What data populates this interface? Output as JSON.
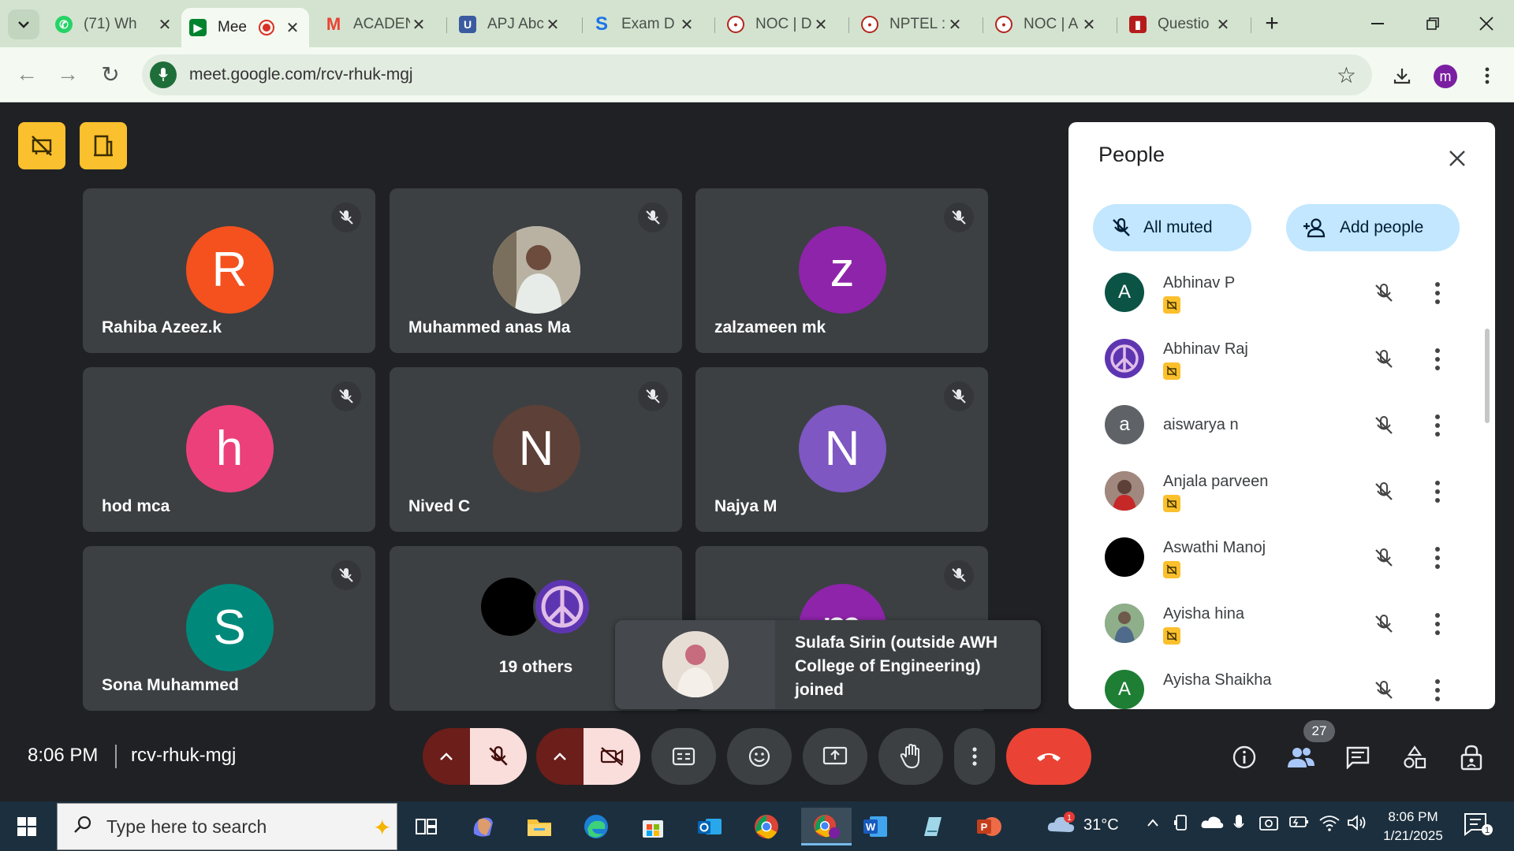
{
  "browser": {
    "tabs": [
      {
        "label": "(71) Wh",
        "favicon": "whatsapp-icon",
        "color": "#25d366"
      },
      {
        "label": "Mee",
        "favicon": "meet-icon",
        "color": "#00832d",
        "active": true,
        "recording": true
      },
      {
        "label": "ACADEN",
        "favicon": "gmail-icon",
        "color": "#ea4335"
      },
      {
        "label": "APJ Abc",
        "favicon": "university-icon",
        "color": "#3a5ba0"
      },
      {
        "label": "Exam D",
        "favicon": "s-icon",
        "color": "#1a73e8"
      },
      {
        "label": "NOC | D",
        "favicon": "nptel-icon",
        "color": "#b3261e"
      },
      {
        "label": "NPTEL :",
        "favicon": "nptel-icon",
        "color": "#b3261e"
      },
      {
        "label": "NOC | A",
        "favicon": "nptel-icon",
        "color": "#b3261e"
      },
      {
        "label": "Questio",
        "favicon": "ktu-icon",
        "color": "#b71c1c"
      }
    ],
    "url": "meet.google.com/rcv-rhuk-mgj",
    "profile_initial": "m"
  },
  "tiles": [
    {
      "name": "Rahiba Azeez.k",
      "initial": "R",
      "color": "#f4511e"
    },
    {
      "name": "Muhammed anas Ma",
      "initial": "",
      "color": "#cfd8dc",
      "photo": true
    },
    {
      "name": "zalzameen mk",
      "initial": "z",
      "color": "#8e24aa"
    },
    {
      "name": "hod mca",
      "initial": "h",
      "color": "#ec407a"
    },
    {
      "name": "Nived C",
      "initial": "N",
      "color": "#5d4037"
    },
    {
      "name": "Najya M",
      "initial": "N",
      "color": "#7e57c2"
    },
    {
      "name": "Sona Muhammed",
      "initial": "S",
      "color": "#00897b"
    },
    {
      "name": "19 others",
      "initial": "",
      "color": "#000000"
    },
    {
      "name": "",
      "initial": "m",
      "color": "#8e24aa"
    }
  ],
  "toast": {
    "text": "Sulafa Sirin (outside AWH College of Engineering) joined"
  },
  "people_panel": {
    "title": "People",
    "all_muted_label": "All muted",
    "add_people_label": "Add people",
    "people": [
      {
        "name": "Abhinav P",
        "initial": "A",
        "color": "#0b5345",
        "badge": true
      },
      {
        "name": "Abhinav Raj",
        "initial": "",
        "color": "#5e35b1",
        "badge": true,
        "peace": true
      },
      {
        "name": "aiswarya n",
        "initial": "a",
        "color": "#5f6368",
        "badge": false
      },
      {
        "name": "Anjala parveen",
        "initial": "",
        "color": "#8d6e63",
        "badge": true
      },
      {
        "name": "Aswathi Manoj",
        "initial": "",
        "color": "#000000",
        "badge": true
      },
      {
        "name": "Ayisha hina",
        "initial": "",
        "color": "#7c9a7e",
        "badge": true
      },
      {
        "name": "Ayisha Shaikha",
        "initial": "A",
        "color": "#1e7e34",
        "badge": false
      }
    ]
  },
  "meet_bar": {
    "time": "8:06 PM",
    "meeting_code": "rcv-rhuk-mgj",
    "participant_count": "27"
  },
  "taskbar": {
    "search_placeholder": "Type here to search",
    "temperature": "31°C",
    "time": "8:06 PM",
    "date": "1/21/2025",
    "notification_count": "1"
  }
}
